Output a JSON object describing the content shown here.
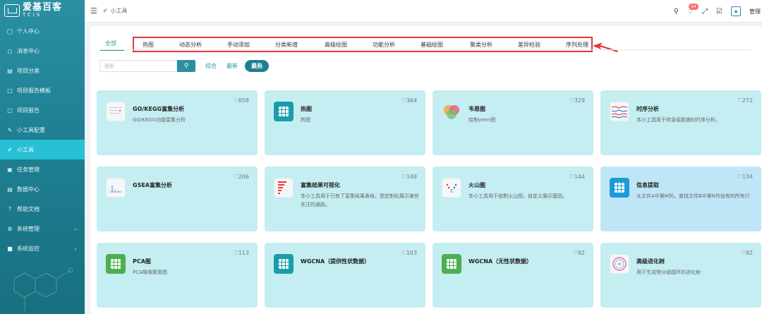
{
  "logo": {
    "title": "爱基百客",
    "subtitle": "TCIS"
  },
  "sidebar": {
    "items": [
      {
        "label": "个人中心",
        "icon": "user-icon"
      },
      {
        "label": "消息中心",
        "icon": "message-icon"
      },
      {
        "label": "项目分类",
        "icon": "category-icon"
      },
      {
        "label": "项目报告模板",
        "icon": "template-icon"
      },
      {
        "label": "项目报告",
        "icon": "report-icon"
      },
      {
        "label": "小工具配置",
        "icon": "config-icon"
      },
      {
        "label": "小工具",
        "icon": "tool-icon",
        "active": true
      },
      {
        "label": "任务管理",
        "icon": "task-icon"
      },
      {
        "label": "数据中心",
        "icon": "data-icon"
      },
      {
        "label": "帮助文档",
        "icon": "help-icon"
      },
      {
        "label": "系统管理",
        "icon": "gear-icon",
        "expandable": true
      },
      {
        "label": "系统监控",
        "icon": "monitor-icon",
        "expandable": true
      }
    ]
  },
  "header": {
    "breadcrumb": "小工具",
    "notification_count": "64",
    "user_name": "管理"
  },
  "tabs": {
    "all": "全部",
    "items": [
      "热图",
      "动态分析",
      "手动添加",
      "分类新增",
      "高级绘图",
      "功能分析",
      "基础绘图",
      "聚类分析",
      "差异检验",
      "序列处理"
    ]
  },
  "search": {
    "placeholder": "搜索",
    "button_icon": "search-icon"
  },
  "sort": {
    "options": [
      "综合",
      "最新"
    ],
    "active": "最热"
  },
  "cards": [
    {
      "title": "GO/KEGG富集分析",
      "desc": "GO/KEGG功能富集分析",
      "likes": "♡658",
      "thumb": "image"
    },
    {
      "title": "热图",
      "desc": "热图",
      "likes": "♡364",
      "thumb": "grid"
    },
    {
      "title": "韦恩图",
      "desc": "绘制venn图",
      "likes": "♡329",
      "thumb": "venn"
    },
    {
      "title": "时序分析",
      "desc": "本小工具用于转录组数据的时序分析。",
      "likes": "♡272",
      "thumb": "image"
    },
    {
      "title": "GSEA富集分析",
      "desc": "",
      "likes": "♡206",
      "thumb": "image"
    },
    {
      "title": "富集结果可视化",
      "desc": "本小工具用于已有了富集结果表格，想定制化展示某些关注的通路。",
      "likes": "♡149",
      "thumb": "image"
    },
    {
      "title": "火山图",
      "desc": "本小工具用于绘制火山图，自定义展示基因。",
      "likes": "♡144",
      "thumb": "image"
    },
    {
      "title": "信息提取",
      "desc": "从文件A中第M列，查找文件B中第N列含有的所有行",
      "likes": "♡134",
      "thumb": "grid-blue"
    },
    {
      "title": "PCA图",
      "desc": "PCA降维聚类图",
      "likes": "♡113",
      "thumb": "grid-green"
    },
    {
      "title": "WGCNA（提供性状数据）",
      "desc": "",
      "likes": "♡103",
      "thumb": "grid"
    },
    {
      "title": "WGCNA（无性状数据）",
      "desc": "",
      "likes": "♡92",
      "thumb": "grid-green"
    },
    {
      "title": "高级进化树",
      "desc": "用于生成带分组圆环的进化树",
      "likes": "♡92",
      "thumb": "circle"
    }
  ],
  "colors": {
    "primary": "#2a8fa3",
    "card_bg": "#c4eef2",
    "highlight_border": "#e03a3a"
  }
}
